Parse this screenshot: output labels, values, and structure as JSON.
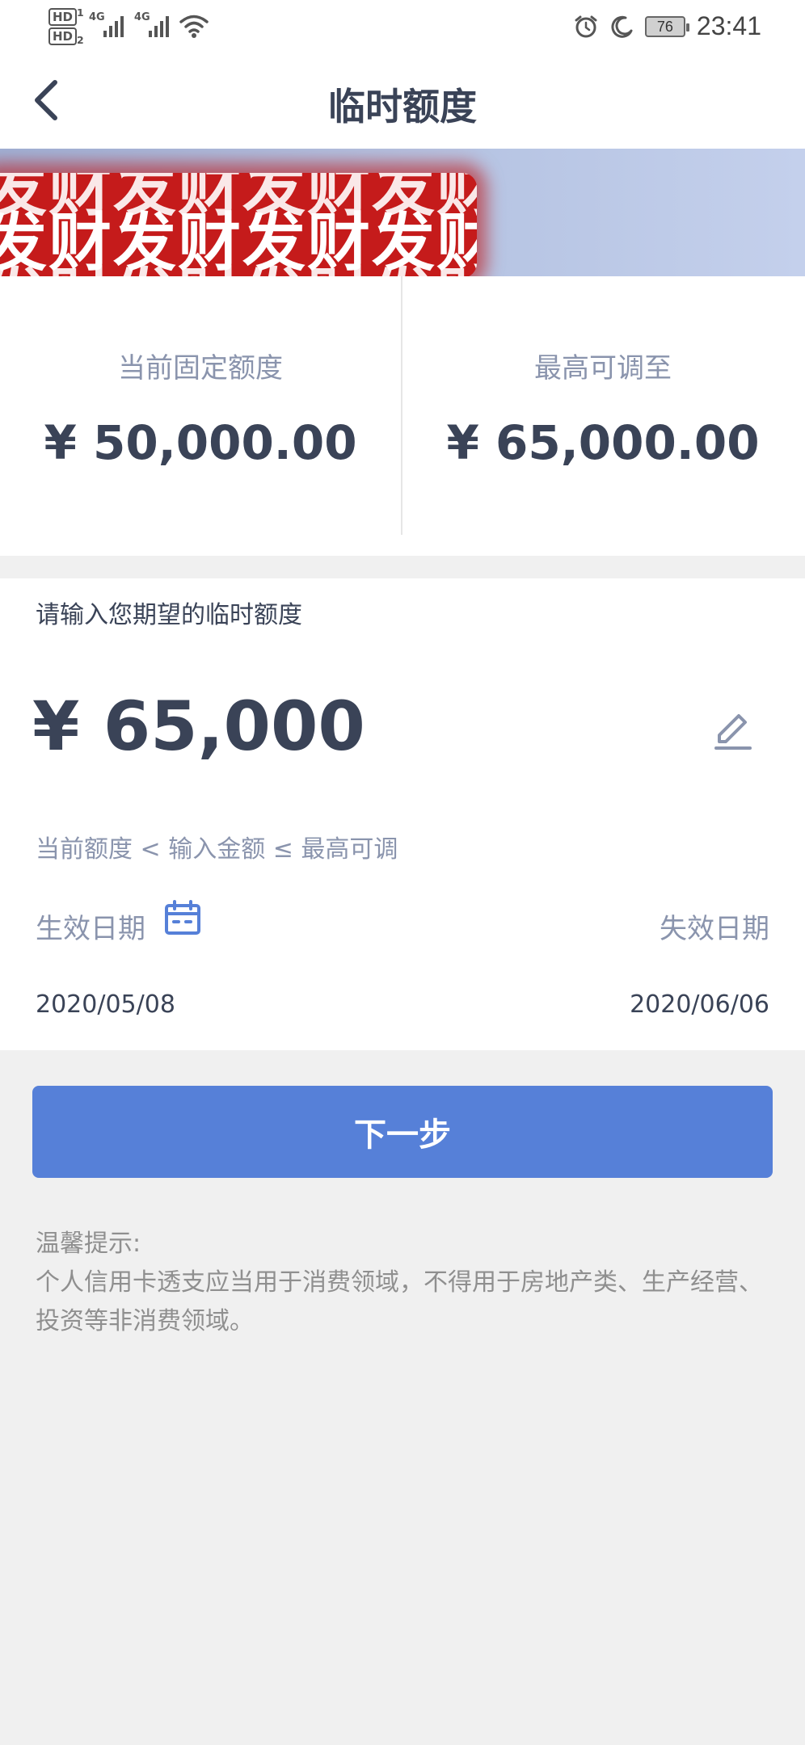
{
  "status_bar": {
    "sim1": "HD",
    "sim1_num": "1",
    "sim2": "HD",
    "sim2_num": "2",
    "net1": "4G",
    "net2": "4G",
    "battery": "76",
    "time": "23:41",
    "icons": [
      "alarm-icon",
      "moon-icon",
      "battery-icon",
      "wifi-icon",
      "signal-icon"
    ]
  },
  "nav": {
    "title": "临时额度",
    "back_icon": "chevron-left-icon"
  },
  "banner": {
    "text_row": "发财发财发财发财"
  },
  "limits": {
    "current_label": "当前固定额度",
    "current_amount": "¥ 50,000.00",
    "max_label": "最高可调至",
    "max_amount": "¥ 65,000.00"
  },
  "form": {
    "prompt": "请输入您期望的临时额度",
    "amount_value": "¥ 65,000",
    "rule": "当前额度 < 输入金额 ≤ 最高可调",
    "effective_label": "生效日期",
    "expiry_label": "失效日期",
    "effective_date": "2020/05/08",
    "expiry_date": "2020/06/06"
  },
  "actions": {
    "next_label": "下一步"
  },
  "tips": {
    "title": "温馨提示:",
    "body": "个人信用卡透支应当用于消费领域，不得用于房地产类、生产经营、投资等非消费领域。"
  },
  "colors": {
    "primary": "#5680d8",
    "text_dark": "#3a4357",
    "text_muted": "#8a94ad",
    "banner_red": "#c51b1b"
  }
}
